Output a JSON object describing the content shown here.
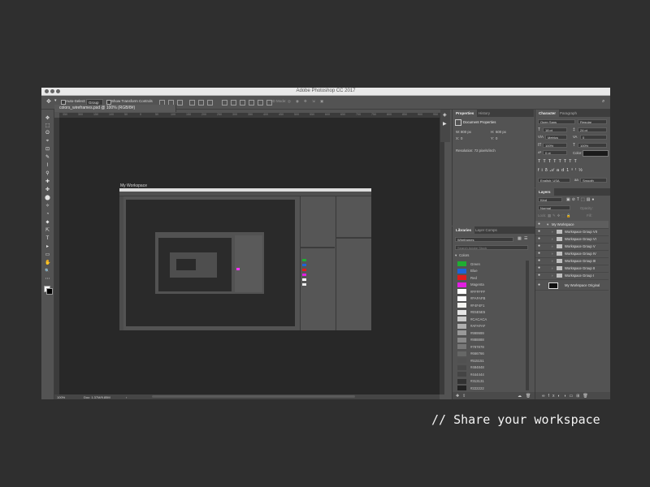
{
  "window": {
    "title": "Adobe Photoshop CC 2017"
  },
  "options_bar": {
    "auto_select_label": "Auto-Select:",
    "auto_select_value": "Group",
    "transform_label": "Show Transform Controls",
    "mode_label": "3D Mode:"
  },
  "document": {
    "tab_title": "colors_wireframes.psd @ 100% (RGB/8#)",
    "zoom": "100%",
    "doc_info": "Doc: 1.37M/9.85M",
    "nested_label": "My Workspace"
  },
  "ruler": {
    "ticks": [
      "350",
      "300",
      "150",
      "100",
      "50",
      "0",
      "50",
      "100",
      "150",
      "200",
      "250",
      "300",
      "350",
      "400",
      "450",
      "500",
      "550",
      "600",
      "650",
      "700",
      "750",
      "800",
      "850",
      "900",
      "950"
    ]
  },
  "tools": [
    "✥",
    "⬚",
    "ʘ",
    "⌖",
    "⊡",
    "✎",
    "⌇",
    "⚲",
    "✚",
    "✤",
    "⬤",
    "✧",
    "◔",
    "⬥",
    "⇱",
    "T",
    "▸",
    "▭",
    "✋",
    "🔍",
    "⋯"
  ],
  "properties": {
    "tabs": [
      "Properties",
      "History"
    ],
    "heading": "Document Properties",
    "w_label": "W:",
    "w_value": "800 px",
    "h_label": "H:",
    "h_value": "600 px",
    "x_label": "X:",
    "x_value": "0",
    "y_label": "Y:",
    "y_value": "0",
    "resolution": "Resolution: 72 pixels/inch"
  },
  "character": {
    "tabs": [
      "Character",
      "Paragraph"
    ],
    "font": "Open Sans",
    "style": "Regular",
    "size": "18 pt",
    "leading": "24 pt",
    "kerning": "Metrics",
    "tracking": "0",
    "vscale": "100%",
    "hscale": "100%",
    "baseline": "0 pt",
    "color_label": "Color:",
    "lang": "English: USA",
    "aa_label": "aa",
    "aa": "Smooth"
  },
  "libraries": {
    "tabs": [
      "Libraries",
      "Layer Comps"
    ],
    "library": "Wireframes",
    "search_placeholder": "Search Adobe Stock",
    "group": "Colors",
    "colors": [
      {
        "name": "Green",
        "hex": "#1fae32"
      },
      {
        "name": "Blue",
        "hex": "#1e64d8"
      },
      {
        "name": "Red",
        "hex": "#e01b1b"
      },
      {
        "name": "Magenta",
        "hex": "#e21ee2"
      },
      {
        "name": "#FFFFFF",
        "hex": "#FFFFFF"
      },
      {
        "name": "#FAFAFB",
        "hex": "#FAFAFB"
      },
      {
        "name": "#F4F4F1",
        "hex": "#F4F4F1"
      },
      {
        "name": "#E5E5E5",
        "hex": "#E5E5E5"
      },
      {
        "name": "#CACACA",
        "hex": "#CACACA"
      },
      {
        "name": "#AFAFAF",
        "hex": "#AFAFAF"
      },
      {
        "name": "#999999",
        "hex": "#999999"
      },
      {
        "name": "#888888",
        "hex": "#888888"
      },
      {
        "name": "#787878",
        "hex": "#787878"
      },
      {
        "name": "#666766",
        "hex": "#666766"
      },
      {
        "name": "#515151",
        "hex": "#515151"
      },
      {
        "name": "#484848",
        "hex": "#484848"
      },
      {
        "name": "#444444",
        "hex": "#444444"
      },
      {
        "name": "#313131",
        "hex": "#313131"
      },
      {
        "name": "#222222",
        "hex": "#222222"
      }
    ]
  },
  "layers": {
    "tab": "Layers",
    "filter": "Kind",
    "blend": "Normal",
    "opacity_label": "Opacity:",
    "lock_label": "Lock:",
    "fill_label": "Fill:",
    "items": [
      {
        "name": "My Workspace",
        "indent": 0
      },
      {
        "name": "Workspace Group VII",
        "indent": 1
      },
      {
        "name": "Workspace Group VI",
        "indent": 1
      },
      {
        "name": "Workspace Group V",
        "indent": 1
      },
      {
        "name": "Workspace Group IV",
        "indent": 1
      },
      {
        "name": "Workspace Group III",
        "indent": 1
      },
      {
        "name": "Workspace Group II",
        "indent": 1
      },
      {
        "name": "Workspace Group I",
        "indent": 1
      },
      {
        "name": "My Workspace Original",
        "indent": 0
      }
    ]
  },
  "caption": "// Share your workspace"
}
